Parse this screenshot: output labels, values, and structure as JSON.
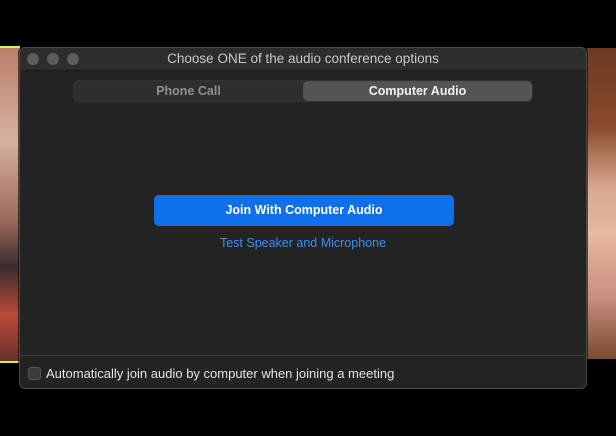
{
  "window": {
    "title": "Choose ONE of the audio conference options"
  },
  "tabs": [
    {
      "label": "Phone Call",
      "active": false
    },
    {
      "label": "Computer Audio",
      "active": true
    }
  ],
  "main": {
    "join_button_label": "Join With Computer Audio",
    "test_link_label": "Test Speaker and Microphone"
  },
  "footer": {
    "auto_join_label": "Automatically join audio by computer when joining a meeting",
    "auto_join_checked": false
  },
  "colors": {
    "accent": "#0e71eb",
    "link": "#3d8ef0",
    "window_bg": "#232323"
  }
}
